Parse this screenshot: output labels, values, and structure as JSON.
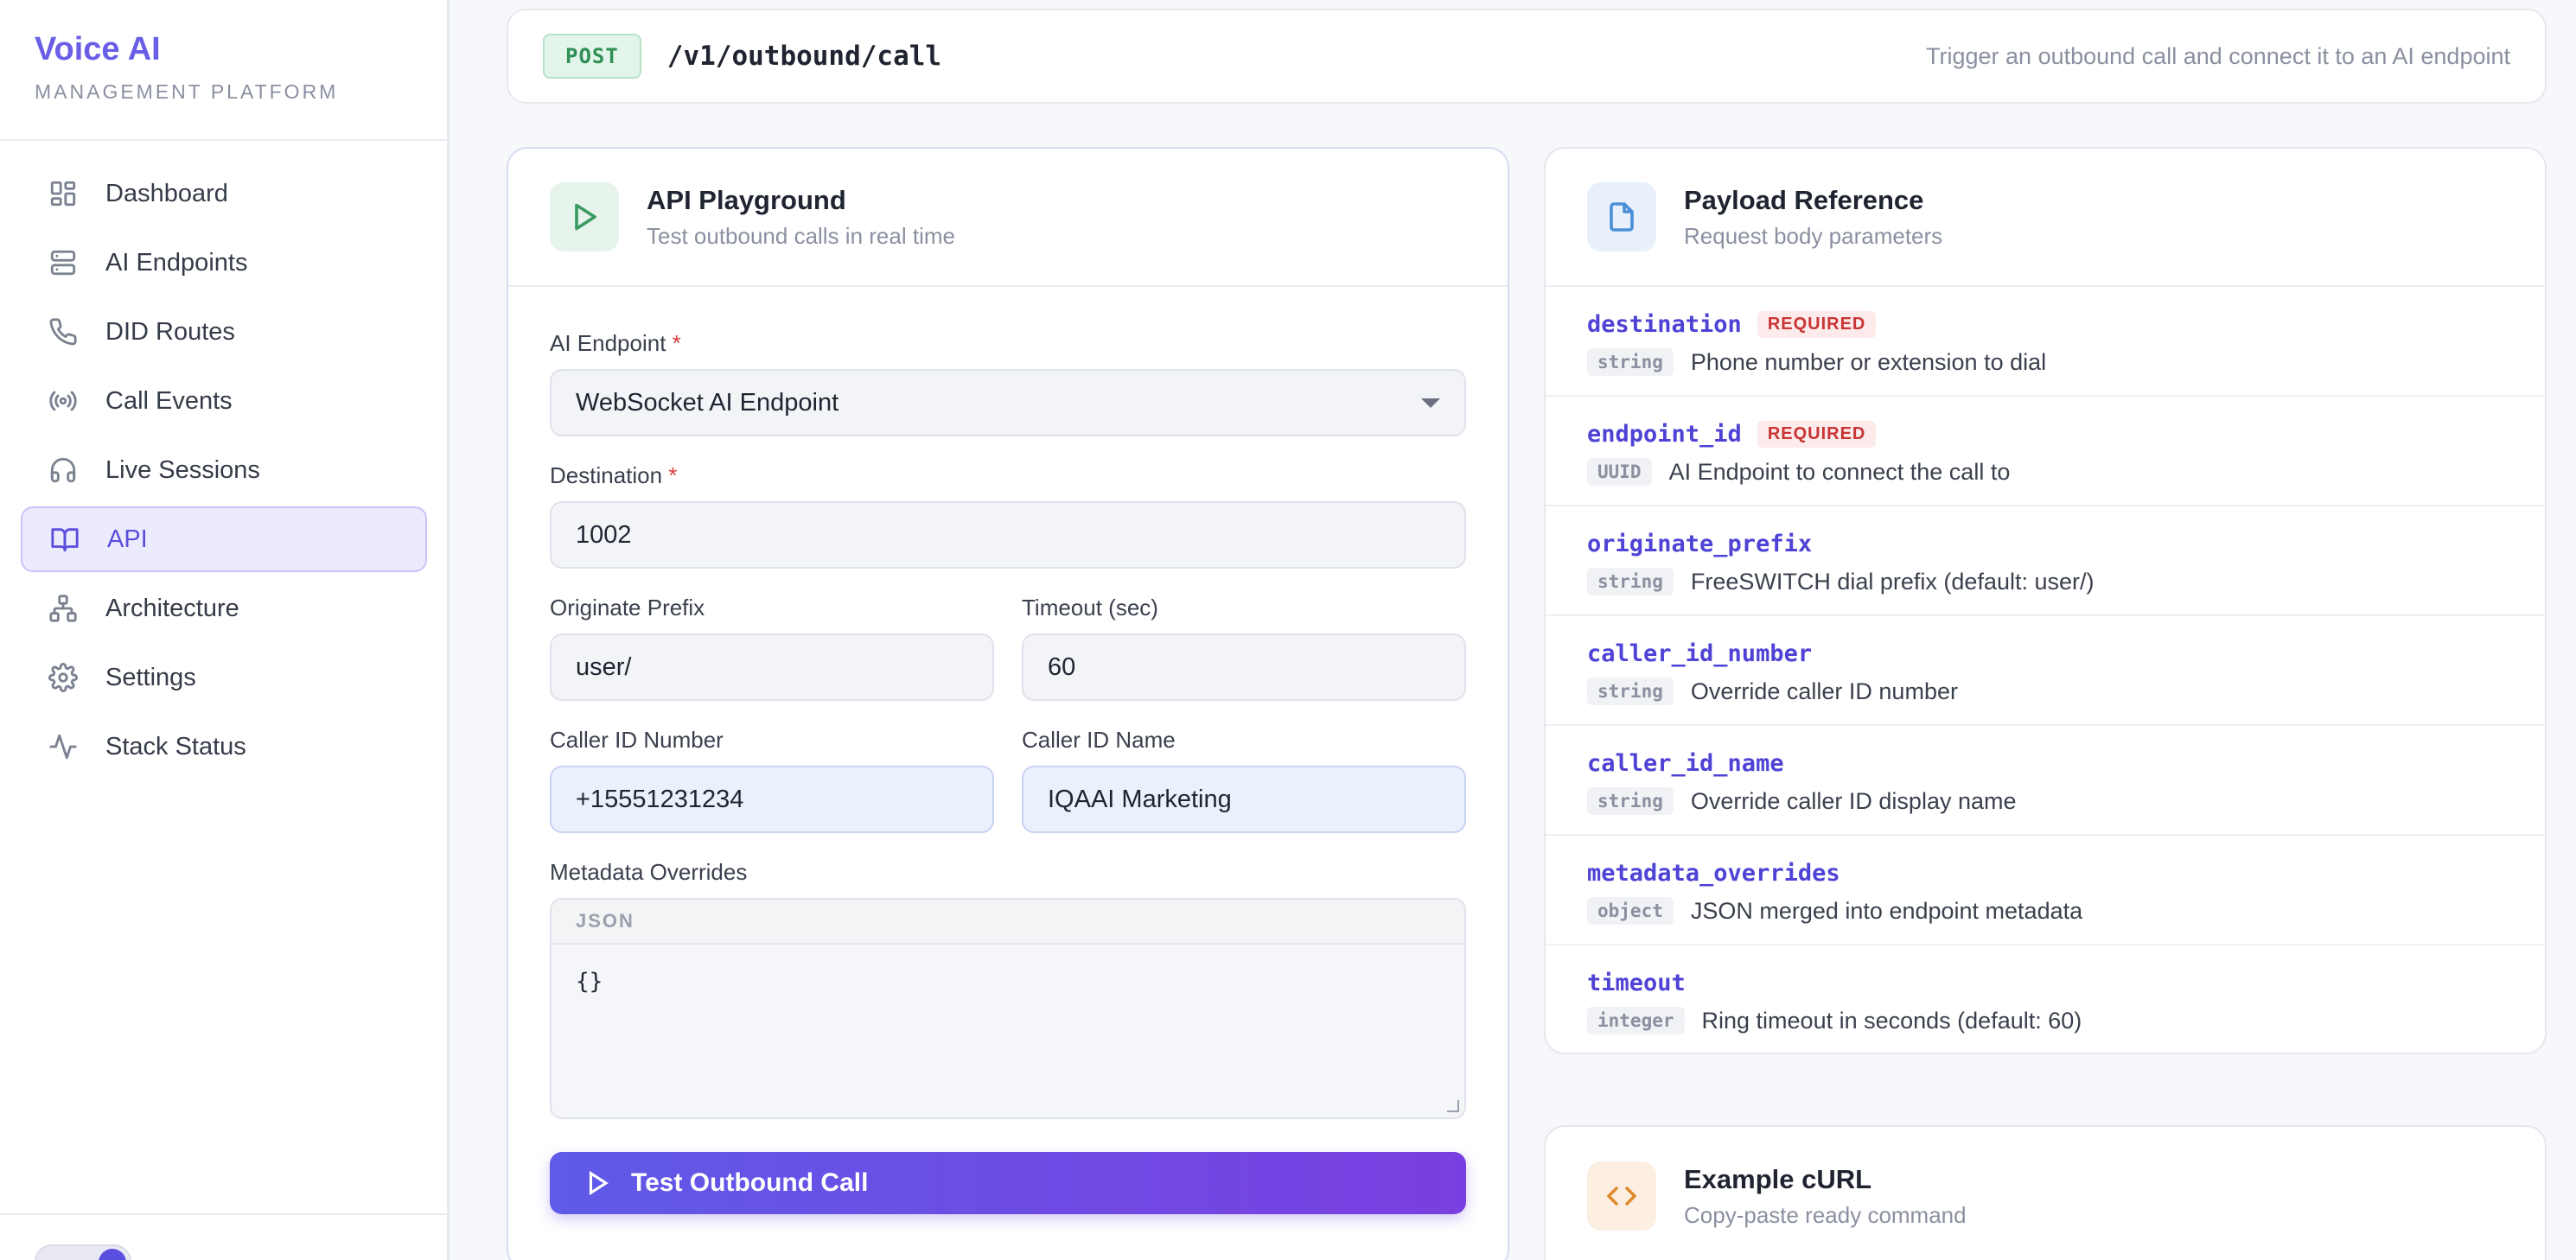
{
  "sidebar": {
    "brand_title": "Voice AI",
    "brand_subtitle": "MANAGEMENT PLATFORM",
    "items": [
      {
        "label": "Dashboard",
        "icon": "grid-icon"
      },
      {
        "label": "AI Endpoints",
        "icon": "server-icon"
      },
      {
        "label": "DID Routes",
        "icon": "phone-icon"
      },
      {
        "label": "Call Events",
        "icon": "broadcast-icon"
      },
      {
        "label": "Live Sessions",
        "icon": "headphones-icon"
      },
      {
        "label": "API",
        "icon": "book-icon",
        "active": true
      },
      {
        "label": "Architecture",
        "icon": "network-icon"
      },
      {
        "label": "Settings",
        "icon": "gear-icon"
      },
      {
        "label": "Stack Status",
        "icon": "activity-icon"
      }
    ]
  },
  "header": {
    "method": "POST",
    "path": "/v1/outbound/call",
    "description": "Trigger an outbound call and connect it to an AI endpoint"
  },
  "playground": {
    "title": "API Playground",
    "subtitle": "Test outbound calls in real time",
    "ai_endpoint_label": "AI Endpoint",
    "ai_endpoint_value": "WebSocket AI Endpoint",
    "destination_label": "Destination",
    "destination_value": "1002",
    "originate_prefix_label": "Originate Prefix",
    "originate_prefix_value": "user/",
    "timeout_label": "Timeout (sec)",
    "timeout_value": "60",
    "caller_id_number_label": "Caller ID Number",
    "caller_id_number_value": "+15551231234",
    "caller_id_name_label": "Caller ID Name",
    "caller_id_name_value": "IQAAI Marketing",
    "metadata_label": "Metadata Overrides",
    "metadata_tab": "JSON",
    "metadata_value": "{}",
    "required_mark": "*",
    "submit_label": "Test Outbound Call"
  },
  "payload": {
    "title": "Payload Reference",
    "subtitle": "Request body parameters",
    "params": [
      {
        "name": "destination",
        "required": "REQUIRED",
        "type": "string",
        "desc": "Phone number or extension to dial"
      },
      {
        "name": "endpoint_id",
        "required": "REQUIRED",
        "type": "UUID",
        "desc": "AI Endpoint to connect the call to"
      },
      {
        "name": "originate_prefix",
        "required": "",
        "type": "string",
        "desc": "FreeSWITCH dial prefix (default: user/)"
      },
      {
        "name": "caller_id_number",
        "required": "",
        "type": "string",
        "desc": "Override caller ID number"
      },
      {
        "name": "caller_id_name",
        "required": "",
        "type": "string",
        "desc": "Override caller ID display name"
      },
      {
        "name": "metadata_overrides",
        "required": "",
        "type": "object",
        "desc": "JSON merged into endpoint metadata"
      },
      {
        "name": "timeout",
        "required": "",
        "type": "integer",
        "desc": "Ring timeout in seconds (default: 60)"
      }
    ]
  },
  "curl": {
    "title": "Example cURL",
    "subtitle": "Copy-paste ready command"
  },
  "colors": {
    "accent": "#5a4fdc",
    "method_green": "#2f8f55",
    "required_red": "#c93434"
  }
}
